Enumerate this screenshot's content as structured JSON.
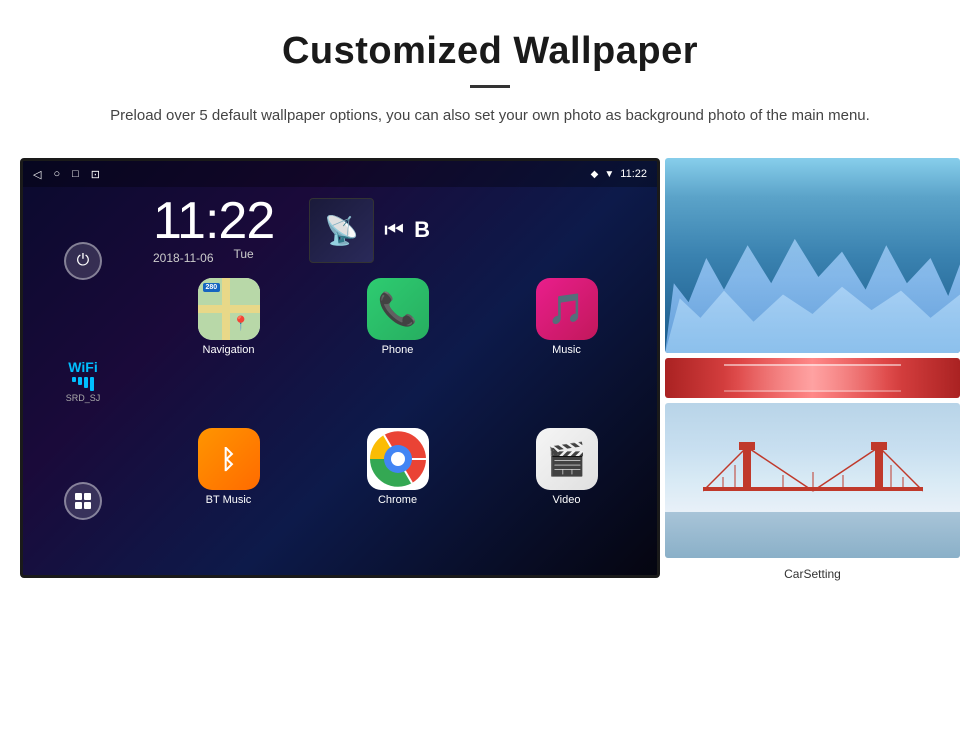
{
  "header": {
    "title": "Customized Wallpaper",
    "description": "Preload over 5 default wallpaper options, you can also set your own photo as background photo of the main menu."
  },
  "device": {
    "status_bar": {
      "time": "11:22",
      "wifi_icon": "▼",
      "location_icon": "◆"
    },
    "clock": {
      "time": "11:22",
      "date": "2018-11-06",
      "day": "Tue"
    },
    "wifi": {
      "label": "WiFi",
      "ssid": "SRD_SJ"
    },
    "apps": [
      {
        "name": "Navigation",
        "icon": "navigation"
      },
      {
        "name": "Phone",
        "icon": "phone"
      },
      {
        "name": "Music",
        "icon": "music"
      },
      {
        "name": "BT Music",
        "icon": "btmusic"
      },
      {
        "name": "Chrome",
        "icon": "chrome"
      },
      {
        "name": "Video",
        "icon": "video"
      }
    ],
    "wallpapers": {
      "label": "CarSetting"
    }
  }
}
